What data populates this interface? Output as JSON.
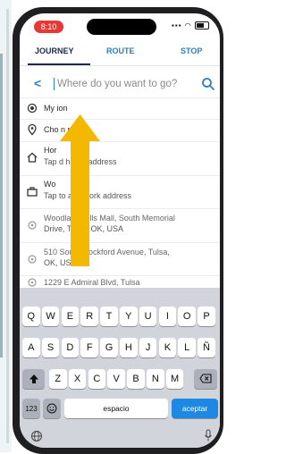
{
  "status": {
    "time": "8:10"
  },
  "tabs": [
    {
      "label": "JOURNEY",
      "active": true
    },
    {
      "label": "ROUTE",
      "active": false
    },
    {
      "label": "STOP",
      "active": false
    }
  ],
  "search": {
    "placeholder": "Where do you want to go?"
  },
  "items": [
    {
      "icon": "location-dot-icon",
      "label": "My location",
      "visible_label": "My     ion"
    },
    {
      "icon": "map-pin-icon",
      "label": "Choose on map",
      "visible_label": "Cho       n map"
    },
    {
      "icon": "home-icon",
      "label": "Home",
      "sub": "Tap to add home address",
      "visible_label": "Hor",
      "visible_sub": "Tap       d home address"
    },
    {
      "icon": "briefcase-icon",
      "label": "Work",
      "sub": "Tap to add work address",
      "visible_label": "Wo",
      "visible_sub": "Tap to add work address"
    },
    {
      "icon": "history-pin-icon",
      "label": "Woodland Hills Mall, South Memorial",
      "sub": "Drive, Tulsa, OK, USA"
    },
    {
      "icon": "history-pin-icon",
      "label": "510 South Rockford Avenue, Tulsa,",
      "sub": "OK, USA"
    },
    {
      "icon": "history-pin-icon",
      "label": "1229 E Admiral Blvd, Tulsa"
    }
  ],
  "keyboard": {
    "row1": [
      "Q",
      "W",
      "E",
      "R",
      "T",
      "Y",
      "U",
      "I",
      "O",
      "P"
    ],
    "row2": [
      "A",
      "S",
      "D",
      "F",
      "G",
      "H",
      "J",
      "K",
      "L",
      "Ñ"
    ],
    "row3": [
      "Z",
      "X",
      "C",
      "V",
      "B",
      "N",
      "M"
    ],
    "numbers_label": "123",
    "space_label": "espacio",
    "accept_label": "aceptar"
  },
  "colors": {
    "accent": "#2d7fc0",
    "arrow": "#f5b800",
    "accept": "#1e88e5",
    "record": "#e53935"
  }
}
